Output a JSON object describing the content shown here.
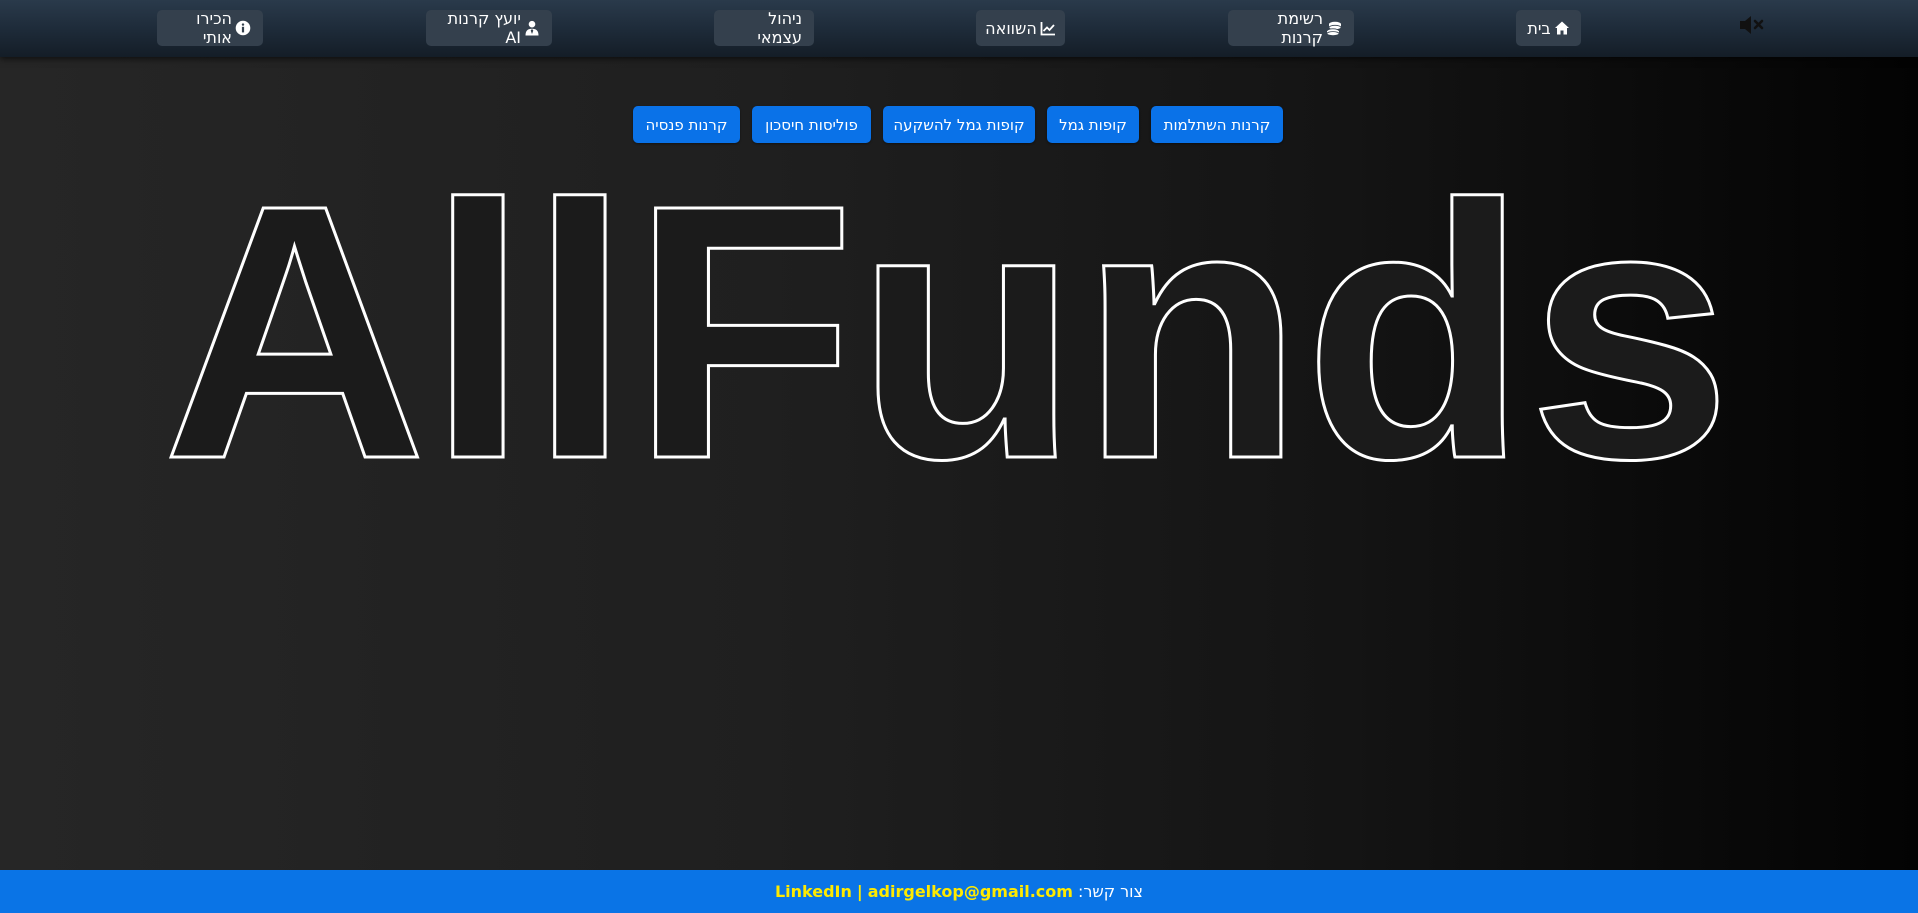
{
  "nav": {
    "mute_icon": "volume-mute-icon",
    "items": [
      {
        "label": "בית",
        "icon": "home-icon"
      },
      {
        "label": "רשימת קרנות",
        "icon": "coins-icon"
      },
      {
        "label": "השוואה",
        "icon": "chart-line-icon"
      },
      {
        "label": "ניהול עצמאי",
        "icon": ""
      },
      {
        "label": "יועץ קרנות AI",
        "icon": "user-tie-icon"
      },
      {
        "label": "הכירו אותי",
        "icon": "info-circle-icon"
      }
    ]
  },
  "categories": [
    {
      "label": "קרנות השתלמות"
    },
    {
      "label": "קופות גמל"
    },
    {
      "label": "קופות גמל להשקעה"
    },
    {
      "label": "פוליסות חיסכון"
    },
    {
      "label": "קרנות פנסיה"
    }
  ],
  "hero": {
    "title": "AllFunds"
  },
  "footer": {
    "contact_label": "צור קשר:",
    "email": "adirgelkop@gmail.com",
    "separator": "|",
    "linkedin": "LinkedIn"
  },
  "colors": {
    "accent": "#0a72e8",
    "footer_link": "#ffea00",
    "nav_button": "#34404d"
  }
}
